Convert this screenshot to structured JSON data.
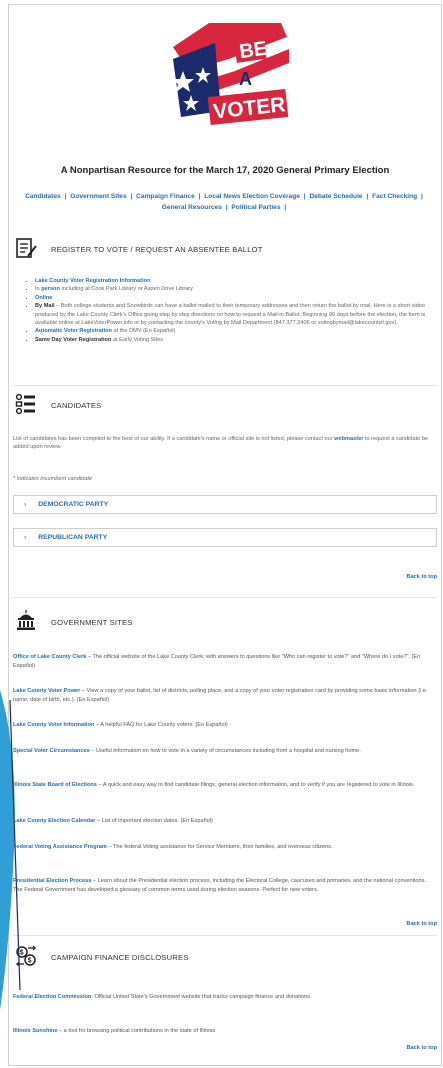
{
  "logo": {
    "line1": "BE",
    "line2": "A",
    "line3": "VOTER!",
    "colors": {
      "red": "#d7263d",
      "navy": "#1b2a6b",
      "white": "#ffffff"
    }
  },
  "subtitle": "A Nonpartisan Resource for the March 17, 2020 General Primary Election",
  "nav": [
    "Candidates",
    "Government Sites",
    "Campaign Finance",
    "Local News Election Coverage",
    "Debate Schedule",
    "Fact Checking",
    "General Resources",
    "Political Parties"
  ],
  "register": {
    "title": "REGISTER TO VOTE / REQUEST AN ABSENTEE BALLOT",
    "icon": "form-icon",
    "items": [
      {
        "link": "Lake County Voter Registration Information",
        "text": ""
      },
      {
        "prefix": "In ",
        "link": "person",
        "text": " including at Cook Park Library or Aspen Drive Library"
      },
      {
        "link": "Online",
        "text": ""
      },
      {
        "bold": "By Mail",
        "text": " – Both college students and Snowbirds can have a ballot mailed to their temporary addresses and then return the ballot by mail. Here is a short video produced by the Lake County Clerk's Office going step by step directions on how to request a Mail-in Ballot. Beginning 90 days before the election, the form is available online at LakeVoterPower.info or by contacting the county's Voting by Mail Department (847.377.2406 or votingbymail@lakecountyil.gov)."
      },
      {
        "link": "Automatic Voter Registration",
        "text": " at the DMV (En Español)"
      },
      {
        "bold": "Same Day Voter Registration",
        "text": " at Early Voting Sites"
      }
    ]
  },
  "candidates": {
    "title": "CANDIDATES",
    "icon": "list-icon",
    "intro_a": "List of candidates has been compiled to the best of our ability. If a candidate's name or official site is not listed, please contact our ",
    "intro_link": "webmaster",
    "intro_b": " to request a candidate be added upon review.",
    "note": "* indicates incumbent candidate",
    "parties": [
      "DEMOCRATIC PARTY",
      "REPUBLICAN PARTY"
    ],
    "back_to_top": "Back to top"
  },
  "government": {
    "title": "GOVERNMENT SITES",
    "icon": "capitol-icon",
    "items": [
      {
        "name": "Office of Lake County Clerk",
        "desc": " – The official website of the Lake County Clerk; with answers to questions like \"Who can register to vote?\" and \"Where do I vote?\". (En Español)"
      },
      {
        "name": "Lake County Voter Power",
        "desc": " – View a copy of your ballot, list of districts, polling place, and a copy of your voter registration card by providing some basic information (i.e. name, date of birth, etc.). (En Español)"
      },
      {
        "name": "Lake County Voter Information",
        "desc": " – A helpful FAQ for Lake County voters. (En Español)"
      },
      {
        "name": "Special Voter Circumstances",
        "desc": " – Useful information on how to vote in a variety of circumstances including from a hospital and nursing home."
      },
      {
        "name": "Illinois State Board of Elections",
        "desc": " – A quick and easy way to find candidate filings, general election information, and to verify if you are registered to vote in Illinois."
      },
      {
        "name": "Lake County Election Calendar",
        "desc": " – List of important election dates. (En Español)"
      },
      {
        "name": "Federal Voting Assistance Program",
        "desc": " – The federal Voting assistance for Service Members, their families, and overseas citizens."
      },
      {
        "name": "Presidential Election Process",
        "desc": " – Learn about the Presidential election process, including the Electoral College, caucuses and primaries, and the national conventions. The Federal Government has developed a glossary of common terms used during election seasons. Perfect for new voters."
      }
    ],
    "back_to_top": "Back to top"
  },
  "finance": {
    "title": "CAMPAIGN FINANCE DISCLOSURES",
    "icon": "money-exchange-icon",
    "items": [
      {
        "name": "Federal Election Commission",
        "desc": ": Official United State's Government website that tracks campaign finance and donations."
      },
      {
        "name": "Illinois Sunshine",
        "desc": " – a tool for browsing political contributions in the state of Illinois"
      }
    ],
    "back_to_top": "Back to top"
  }
}
